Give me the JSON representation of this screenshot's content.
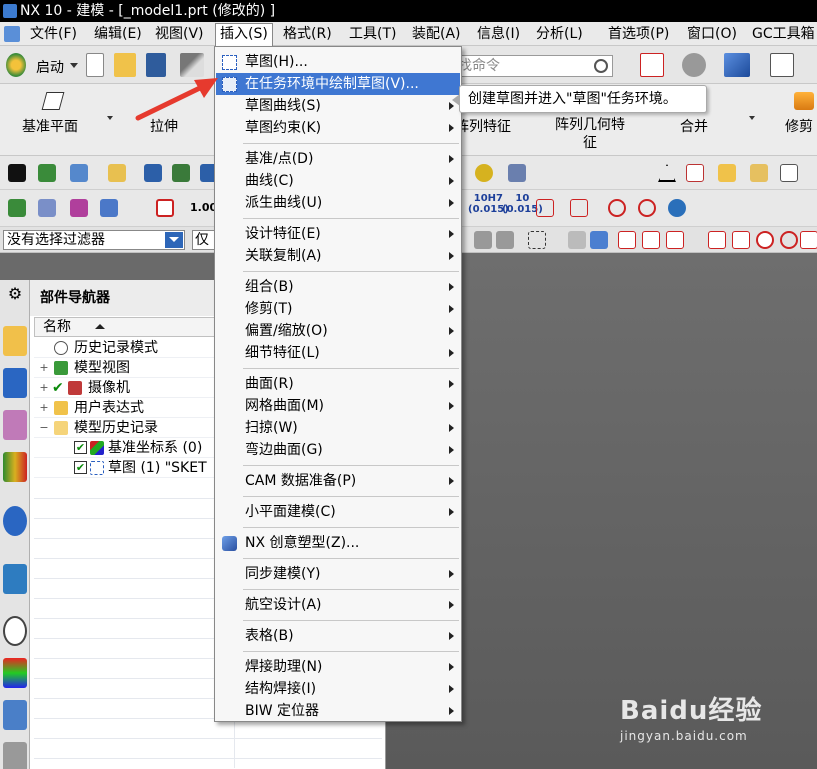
{
  "window": {
    "title": "NX 10 - 建模 - [_model1.prt  (修改的) ]"
  },
  "menubar": {
    "items": [
      "文件(F)",
      "编辑(E)",
      "视图(V)",
      "插入(S)",
      "格式(R)",
      "工具(T)",
      "装配(A)",
      "信息(I)",
      "分析(L)",
      "首选项(P)",
      "窗口(O)",
      "GC工具箱"
    ],
    "active_index": 3
  },
  "toolbar": {
    "start_label": "启动",
    "search_placeholder": "找命令"
  },
  "ribbon": {
    "datum_plane": "基准平面",
    "extrude": "拉伸",
    "pattern_feature": "阵列特征",
    "pattern_geometry": "阵列几何特\n征",
    "unite": "合并",
    "trim": "修剪"
  },
  "iconrow2": {
    "tolerance_1": "1.00",
    "fit_1": "10H7",
    "fit_1_sub": "(0.015)",
    "fit_2": "10",
    "fit_2_sub": "(0.015)"
  },
  "filter": {
    "selection_filter": "没有选择过滤器",
    "scope_prefix": "仅在"
  },
  "navigator": {
    "title": "部件导航器",
    "column_name": "名称",
    "rows": [
      {
        "label": "历史记录模式",
        "indent": 1,
        "expand": "",
        "icon": "clock-icon"
      },
      {
        "label": "模型视图",
        "indent": 1,
        "expand": "+",
        "icon": "cube-icon"
      },
      {
        "label": "摄像机",
        "indent": 1,
        "expand": "+",
        "icon": "camera-icon",
        "check": "✔"
      },
      {
        "label": "用户表达式",
        "indent": 1,
        "expand": "+",
        "icon": "folder-icon"
      },
      {
        "label": "模型历史记录",
        "indent": 1,
        "expand": "−",
        "icon": "folder-open-icon"
      },
      {
        "label": "基准坐标系 (0)",
        "indent": 2,
        "expand": "",
        "icon": "csys-icon",
        "check": "✔"
      },
      {
        "label": "草图 (1) \"SKET",
        "indent": 2,
        "expand": "",
        "icon": "sketch-icon",
        "check": "✔"
      }
    ]
  },
  "insert_menu": {
    "items": [
      {
        "label": "草图(H)...",
        "submenu": false,
        "icon": "sketch-icon"
      },
      {
        "label": "在任务环境中绘制草图(V)...",
        "submenu": false,
        "icon": "task-sketch-icon",
        "highlighted": true
      },
      {
        "label": "草图曲线(S)",
        "submenu": true
      },
      {
        "label": "草图约束(K)",
        "submenu": true
      },
      {
        "separator": true
      },
      {
        "label": "基准/点(D)",
        "submenu": true
      },
      {
        "label": "曲线(C)",
        "submenu": true
      },
      {
        "label": "派生曲线(U)",
        "submenu": true
      },
      {
        "separator": true
      },
      {
        "label": "设计特征(E)",
        "submenu": true
      },
      {
        "label": "关联复制(A)",
        "submenu": true
      },
      {
        "separator": true
      },
      {
        "label": "组合(B)",
        "submenu": true
      },
      {
        "label": "修剪(T)",
        "submenu": true
      },
      {
        "label": "偏置/缩放(O)",
        "submenu": true
      },
      {
        "label": "细节特征(L)",
        "submenu": true
      },
      {
        "separator": true
      },
      {
        "label": "曲面(R)",
        "submenu": true
      },
      {
        "label": "网格曲面(M)",
        "submenu": true
      },
      {
        "label": "扫掠(W)",
        "submenu": true
      },
      {
        "label": "弯边曲面(G)",
        "submenu": true
      },
      {
        "separator": true
      },
      {
        "label": "CAM 数据准备(P)",
        "submenu": true
      },
      {
        "separator": true
      },
      {
        "label": "小平面建模(C)",
        "submenu": true
      },
      {
        "separator": true
      },
      {
        "label": "NX 创意塑型(Z)...",
        "submenu": false,
        "icon": "nx-realize-icon"
      },
      {
        "separator": true
      },
      {
        "label": "同步建模(Y)",
        "submenu": true
      },
      {
        "separator": true
      },
      {
        "label": "航空设计(A)",
        "submenu": true
      },
      {
        "separator": true
      },
      {
        "label": "表格(B)",
        "submenu": true
      },
      {
        "separator": true
      },
      {
        "label": "焊接助理(N)",
        "submenu": true
      },
      {
        "label": "结构焊接(I)",
        "submenu": true
      },
      {
        "label": "BIW 定位器",
        "submenu": true
      }
    ]
  },
  "tooltip": {
    "text": "创建草图并进入\"草图\"任务环境。"
  },
  "watermark": {
    "line1": "Baidu经验",
    "line2": "jingyan.baidu.com"
  },
  "colors": {
    "highlight": "#3f77d2",
    "arrow": "#e63a2e",
    "titlebar": "#000000"
  }
}
